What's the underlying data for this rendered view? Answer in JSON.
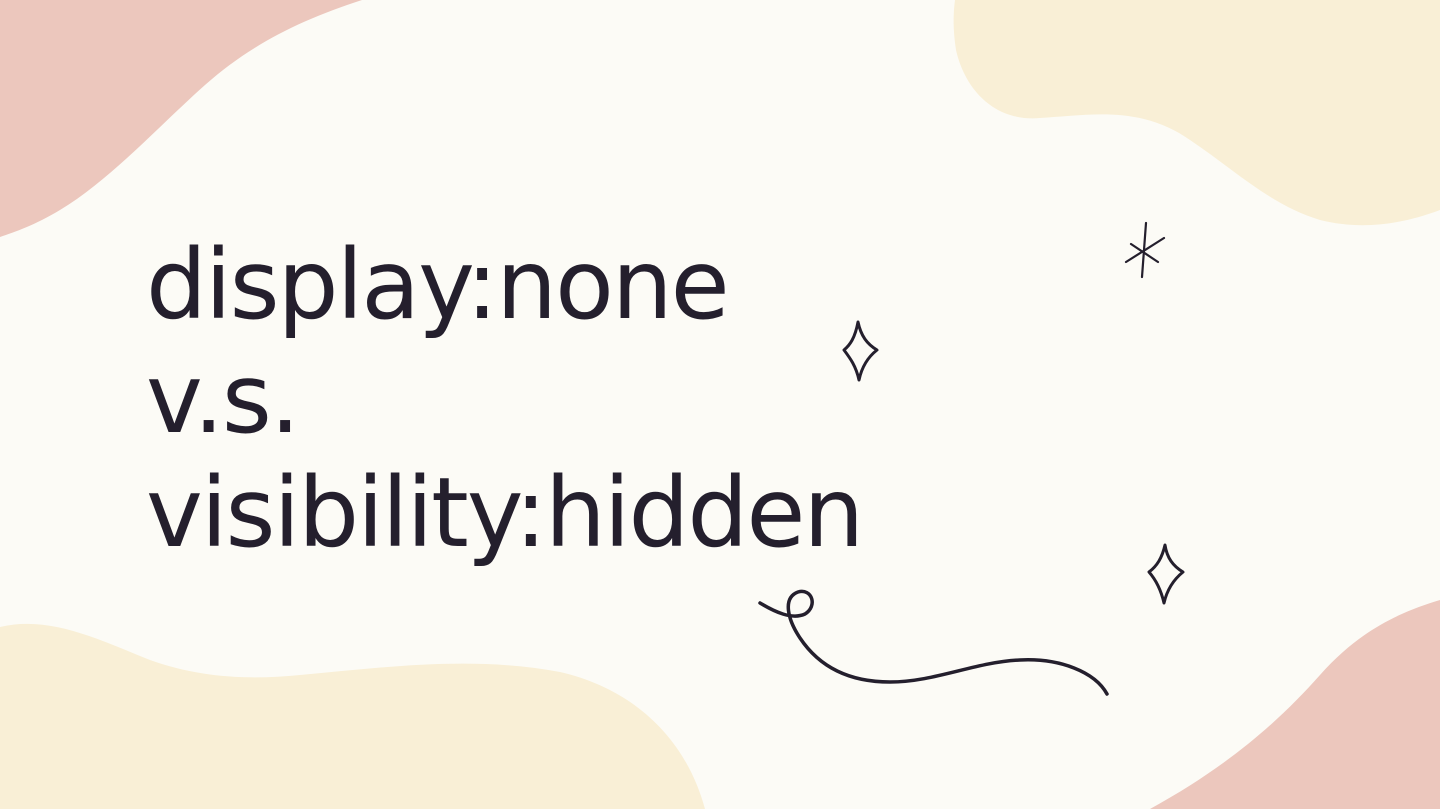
{
  "slide": {
    "title_lines": [
      "display:none",
      "v.s.",
      "visibility:hidden"
    ]
  },
  "colors": {
    "background": "#fcfbf6",
    "blob_pink": "#ecc7bd",
    "blob_cream": "#f9efd6",
    "ink": "#241f2d"
  },
  "decorations": {
    "icons": [
      "asterisk-icon",
      "sparkle-icon",
      "sparkle-icon",
      "squiggle-icon"
    ]
  }
}
